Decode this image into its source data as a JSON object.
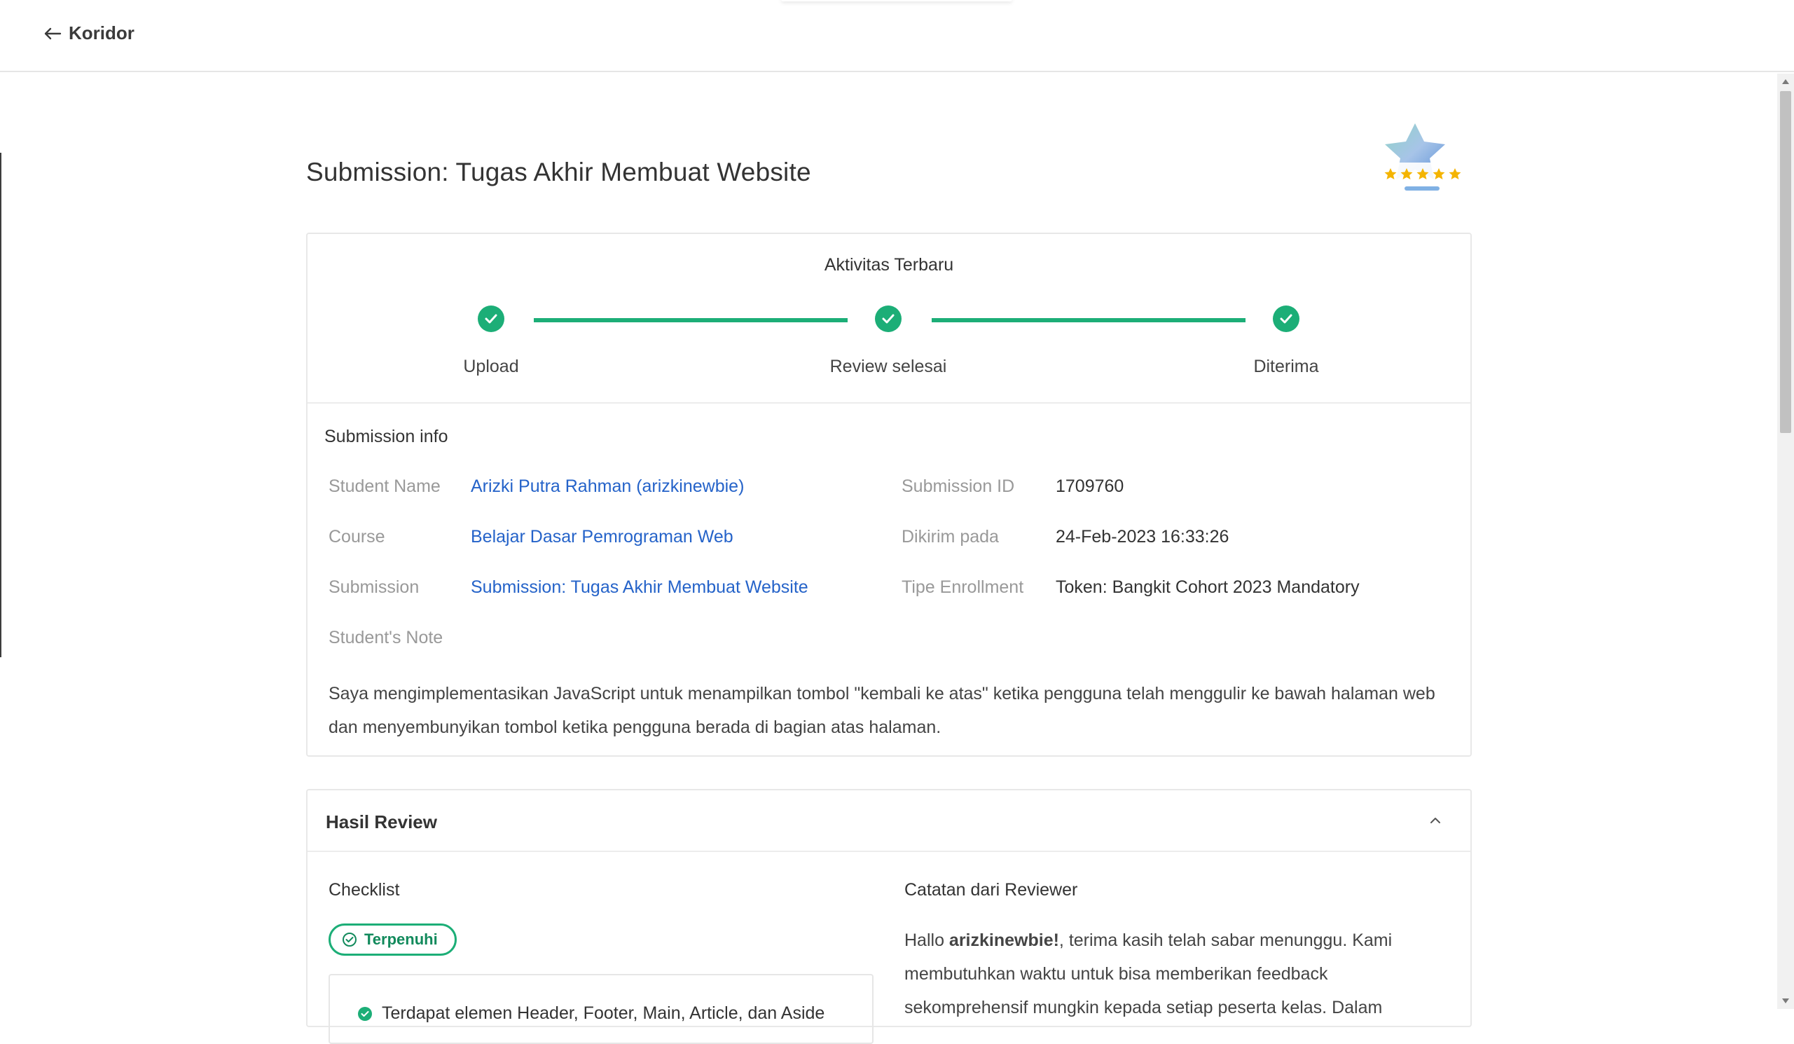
{
  "nav": {
    "back_label": "Koridor"
  },
  "page": {
    "title": "Submission: Tugas Akhir Membuat Website"
  },
  "activity": {
    "title": "Aktivitas Terbaru",
    "steps": [
      {
        "label": "Upload",
        "done": true
      },
      {
        "label": "Review selesai",
        "done": true
      },
      {
        "label": "Diterima",
        "done": true
      }
    ],
    "accent_color": "#1cae77"
  },
  "submission_info": {
    "heading": "Submission info",
    "student_name_label": "Student Name",
    "student_name_value": "Arizki Putra Rahman (arizkinewbie)",
    "course_label": "Course",
    "course_value": "Belajar Dasar Pemrograman Web",
    "submission_label": "Submission",
    "submission_value": "Submission: Tugas Akhir Membuat Website",
    "note_label": "Student's Note",
    "submission_id_label": "Submission ID",
    "submission_id_value": "1709760",
    "sent_at_label": "Dikirim pada",
    "sent_at_value": "24-Feb-2023 16:33:26",
    "enrollment_label": "Tipe Enrollment",
    "enrollment_value": "Token: Bangkit Cohort 2023 Mandatory",
    "note_text": "Saya mengimplementasikan JavaScript untuk menampilkan tombol \"kembali ke atas\" ketika pengguna telah menggulir ke bawah halaman web dan menyembunyikan tombol ketika pengguna berada di bagian atas halaman."
  },
  "review": {
    "heading": "Hasil Review",
    "checklist_heading": "Checklist",
    "status_pill": "Terpenuhi",
    "checklist_item_partial": "Terdapat elemen Header, Footer, Main, Article, dan Aside",
    "reviewer_heading": "Catatan dari Reviewer",
    "reviewer_note_greeting": "Hallo ",
    "reviewer_note_user": "arizkinewbie!",
    "reviewer_note_rest": ", terima kasih telah sabar menunggu. Kami membutuhkan waktu untuk bisa memberikan feedback sekomprehensif mungkin kepada setiap peserta kelas. Dalam"
  },
  "badge": {
    "rating": 5,
    "icon": "star-badge-icon"
  }
}
